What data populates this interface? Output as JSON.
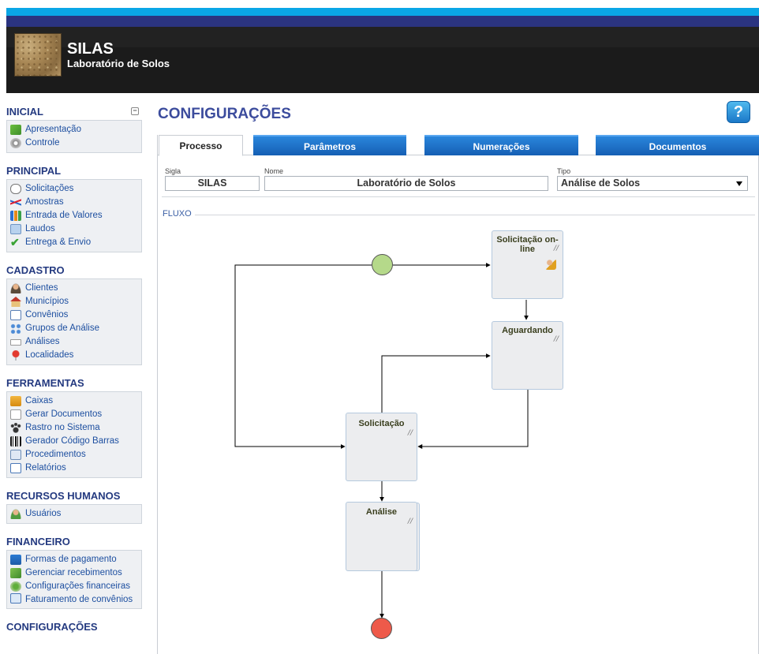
{
  "header": {
    "title": "SILAS",
    "subtitle": "Laboratório de Solos"
  },
  "sidebar": {
    "sections": [
      {
        "title": "INICIAL",
        "items": [
          "Apresentação",
          "Controle"
        ]
      },
      {
        "title": "PRINCIPAL",
        "items": [
          "Solicitações",
          "Amostras",
          "Entrada de Valores",
          "Laudos",
          "Entrega & Envio"
        ]
      },
      {
        "title": "CADASTRO",
        "items": [
          "Clientes",
          "Municípios",
          "Convênios",
          "Grupos de Análise",
          "Análises",
          "Localidades"
        ]
      },
      {
        "title": "FERRAMENTAS",
        "items": [
          "Caixas",
          "Gerar Documentos",
          "Rastro no Sistema",
          "Gerador Código Barras",
          "Procedimentos",
          "Relatórios"
        ]
      },
      {
        "title": "RECURSOS HUMANOS",
        "items": [
          "Usuários"
        ]
      },
      {
        "title": "FINANCEIRO",
        "items": [
          "Formas de pagamento",
          "Gerenciar recebimentos",
          "Configurações financeiras",
          "Faturamento de convênios"
        ]
      },
      {
        "title": "CONFIGURAÇÕES",
        "items": []
      }
    ]
  },
  "main": {
    "title": "CONFIGURAÇÕES",
    "help_label": "?",
    "tabs": [
      "Processo",
      "Parâmetros",
      "Numerações",
      "Documentos"
    ],
    "fields": {
      "sigla_label": "Sigla",
      "sigla_value": "SILAS",
      "nome_label": "Nome",
      "nome_value": "Laboratório de Solos",
      "tipo_label": "Tipo",
      "tipo_value": "Análise de Solos"
    },
    "fluxo_label": "FLUXO",
    "flow_nodes": [
      "Solicitação on-line",
      "Aguardando",
      "Solicitação",
      "Análise"
    ]
  },
  "colors": {
    "accent": "#3c4c9d",
    "tab_blue": "#1d6fc8",
    "start": "#b5d98a",
    "end": "#ee5a4a"
  }
}
